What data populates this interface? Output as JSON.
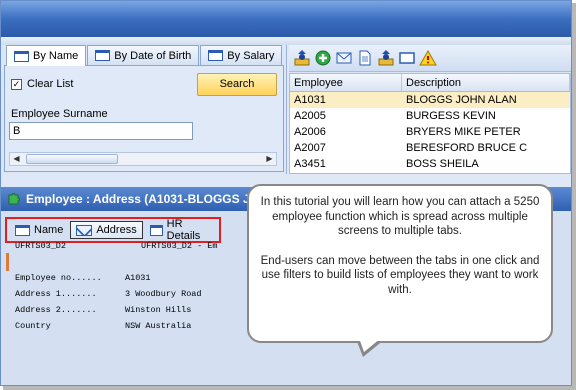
{
  "search_tabs": [
    "By Name",
    "By Date of Birth",
    "By Salary"
  ],
  "search": {
    "clear_list_label": "Clear List",
    "clear_list_checked": true,
    "search_button": "Search",
    "surname_label": "Employee Surname",
    "surname_value": "B"
  },
  "grid": {
    "headers": [
      "Employee",
      "Description"
    ],
    "rows": [
      {
        "employee": "A1031",
        "description": "BLOGGS JOHN ALAN"
      },
      {
        "employee": "A2005",
        "description": "BURGESS KEVIN"
      },
      {
        "employee": "A2006",
        "description": "BRYERS MIKE PETER"
      },
      {
        "employee": "A2007",
        "description": "BERESFORD BRUCE C"
      },
      {
        "employee": "A3451",
        "description": "BOSS SHEILA"
      }
    ]
  },
  "employee_panel": {
    "title": "Employee : Address (A1031-BLOGGS J",
    "tabs": [
      "Name",
      "Address",
      "HR Details"
    ],
    "screen_id": "UFRTS03_D2",
    "screen_id_right": "UFRTS03_D2 - Em",
    "fields": [
      {
        "label": "Employee no......",
        "value": "A1031"
      },
      {
        "label": "Address 1.......",
        "value": "3 Woodbury Road"
      },
      {
        "label": "Address 2.......",
        "value": "Winston Hills"
      },
      {
        "label": "Country",
        "value": "NSW Australia"
      }
    ]
  },
  "callout": {
    "paragraph1": "In this tutorial you will learn how you can attach a 5250 employee function which is spread across multiple screens to multiple tabs.",
    "paragraph2": "End-users can move between the tabs in one click and use filters to build lists of employees they want to work with."
  },
  "colors": {
    "title_bar": "#2e5fb1",
    "selected_row": "#fbeec5",
    "highlight_box": "#e02020",
    "search_button": "#ffd25a"
  }
}
